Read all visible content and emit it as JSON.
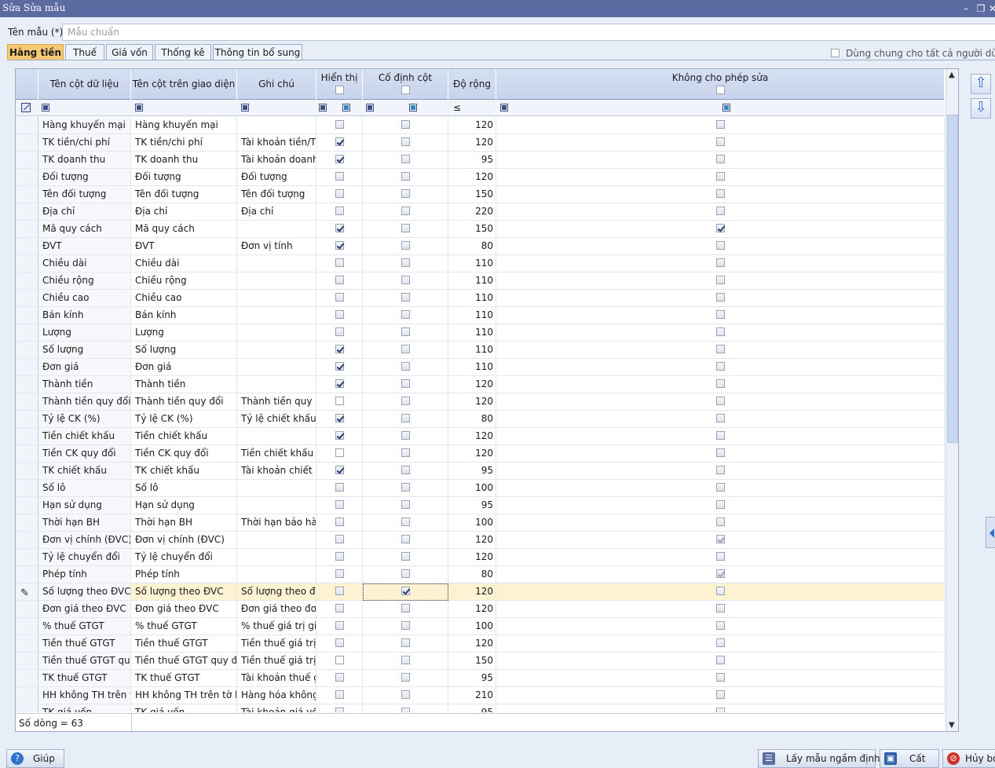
{
  "window": {
    "title": "Sửa Sửa mẫu"
  },
  "form": {
    "name_label": "Tên mẫu (*)",
    "name_value": "Mẫu chuẩn"
  },
  "tabs": [
    "Hàng tiền",
    "Thuế",
    "Giá vốn",
    "Thống kê",
    "Thông tin bổ sung"
  ],
  "shared_label": "Dùng chung cho tất cả người dùng khác",
  "columns": {
    "data_name": "Tên cột dữ liệu",
    "ui_name": "Tên cột trên giao diện",
    "note": "Ghi chú",
    "show": "Hiển thị",
    "fixed": "Cố định cột",
    "width": "Độ rộng",
    "noedit": "Không cho phép sửa"
  },
  "filter_width_op": "≤",
  "rows": [
    {
      "name": "Hàng khuyến mại",
      "ui": "Hàng khuyến mại",
      "note": "",
      "show": "off",
      "fixed": "off",
      "width": "120",
      "noedit": "off"
    },
    {
      "name": "TK tiền/chi phí",
      "ui": "TK tiền/chi phí",
      "note": "Tài khoản tiền/Tài",
      "show": "on",
      "fixed": "off",
      "width": "120",
      "noedit": "off"
    },
    {
      "name": "TK doanh thu",
      "ui": "TK doanh thu",
      "note": "Tài khoản doanh t",
      "show": "on",
      "fixed": "off",
      "width": "95",
      "noedit": "off"
    },
    {
      "name": "Đối tượng",
      "ui": "Đối tượng",
      "note": "Đối tượng",
      "show": "off",
      "fixed": "off",
      "width": "120",
      "noedit": "off"
    },
    {
      "name": "Tên đối tượng",
      "ui": "Tên đối tượng",
      "note": "Tên đối tượng",
      "show": "off",
      "fixed": "off",
      "width": "150",
      "noedit": "off"
    },
    {
      "name": "Địa chỉ",
      "ui": "Địa chỉ",
      "note": "Địa chỉ",
      "show": "off",
      "fixed": "off",
      "width": "220",
      "noedit": "off"
    },
    {
      "name": "Mã quy cách",
      "ui": "Mã quy cách",
      "note": "",
      "show": "on",
      "fixed": "off",
      "width": "150",
      "noedit": "on"
    },
    {
      "name": "ĐVT",
      "ui": "ĐVT",
      "note": "Đơn vị tính",
      "show": "on",
      "fixed": "off",
      "width": "80",
      "noedit": "off"
    },
    {
      "name": "Chiều dài",
      "ui": "Chiều dài",
      "note": "",
      "show": "off",
      "fixed": "off",
      "width": "110",
      "noedit": "off"
    },
    {
      "name": "Chiều rộng",
      "ui": "Chiều rộng",
      "note": "",
      "show": "off",
      "fixed": "off",
      "width": "110",
      "noedit": "off"
    },
    {
      "name": "Chiều cao",
      "ui": "Chiều cao",
      "note": "",
      "show": "off",
      "fixed": "off",
      "width": "110",
      "noedit": "off"
    },
    {
      "name": "Bán kính",
      "ui": "Bán kính",
      "note": "",
      "show": "off",
      "fixed": "off",
      "width": "110",
      "noedit": "off"
    },
    {
      "name": "Lượng",
      "ui": "Lượng",
      "note": "",
      "show": "off",
      "fixed": "off",
      "width": "110",
      "noedit": "off"
    },
    {
      "name": "Số lượng",
      "ui": "Số lượng",
      "note": "",
      "show": "on",
      "fixed": "off",
      "width": "110",
      "noedit": "off"
    },
    {
      "name": "Đơn giá",
      "ui": "Đơn giá",
      "note": "",
      "show": "on",
      "fixed": "off",
      "width": "110",
      "noedit": "off"
    },
    {
      "name": "Thành tiền",
      "ui": "Thành tiền",
      "note": "",
      "show": "on",
      "fixed": "off",
      "width": "120",
      "noedit": "off"
    },
    {
      "name": "Thành tiền quy đổi",
      "ui": "Thành tiền quy đổi",
      "note": "Thành tiền quy đổ",
      "show": "blank",
      "fixed": "off",
      "width": "120",
      "noedit": "off"
    },
    {
      "name": "Tỷ lệ CK (%)",
      "ui": "Tỷ lệ CK (%)",
      "note": "Tỷ lệ chiết khấu (",
      "show": "on",
      "fixed": "off",
      "width": "80",
      "noedit": "off"
    },
    {
      "name": "Tiền chiết khấu",
      "ui": "Tiền chiết khấu",
      "note": "",
      "show": "on",
      "fixed": "off",
      "width": "120",
      "noedit": "off"
    },
    {
      "name": "Tiền CK quy đổi",
      "ui": "Tiền CK quy đổi",
      "note": "Tiền chiết khấu q",
      "show": "blank",
      "fixed": "off",
      "width": "120",
      "noedit": "off"
    },
    {
      "name": "TK chiết khấu",
      "ui": "TK chiết khấu",
      "note": "Tài khoản chiết k",
      "show": "on",
      "fixed": "off",
      "width": "95",
      "noedit": "off"
    },
    {
      "name": "Số lô",
      "ui": "Số lô",
      "note": "",
      "show": "off",
      "fixed": "off",
      "width": "100",
      "noedit": "off"
    },
    {
      "name": "Hạn sử dụng",
      "ui": "Hạn sử dụng",
      "note": "",
      "show": "off",
      "fixed": "off",
      "width": "95",
      "noedit": "off"
    },
    {
      "name": "Thời hạn BH",
      "ui": "Thời hạn BH",
      "note": "Thời hạn bảo hàn",
      "show": "off",
      "fixed": "off",
      "width": "100",
      "noedit": "off"
    },
    {
      "name": "Đơn vị chính (ĐVC)",
      "ui": "Đơn vị chính (ĐVC)",
      "note": "",
      "show": "off",
      "fixed": "off",
      "width": "120",
      "noedit": "dim"
    },
    {
      "name": "Tỷ lệ chuyển đổi",
      "ui": "Tỷ lệ chuyển đổi",
      "note": "",
      "show": "off",
      "fixed": "off",
      "width": "120",
      "noedit": "off"
    },
    {
      "name": "Phép tính",
      "ui": "Phép tính",
      "note": "",
      "show": "off",
      "fixed": "off",
      "width": "80",
      "noedit": "dim"
    },
    {
      "name": "Số lượng theo ĐVC",
      "ui": "Số lượng theo ĐVC",
      "note": "Số lượng theo đơ",
      "show": "off",
      "fixed": "on",
      "width": "120",
      "noedit": "off",
      "selected": true
    },
    {
      "name": "Đơn giá theo ĐVC",
      "ui": "Đơn giá theo ĐVC",
      "note": "Đơn giá theo đơn",
      "show": "off",
      "fixed": "off",
      "width": "120",
      "noedit": "off"
    },
    {
      "name": "% thuế GTGT",
      "ui": "% thuế GTGT",
      "note": "% thuế giá trị gia t",
      "show": "off",
      "fixed": "off",
      "width": "100",
      "noedit": "off"
    },
    {
      "name": "Tiền thuế GTGT",
      "ui": "Tiền thuế GTGT",
      "note": "Tiền thuế giá trị gi",
      "show": "off",
      "fixed": "off",
      "width": "120",
      "noedit": "off"
    },
    {
      "name": "Tiền thuế GTGT quy",
      "ui": "Tiền thuế GTGT quy đổi",
      "note": "Tiền thuế giá trị gi",
      "show": "blank",
      "fixed": "off",
      "width": "150",
      "noedit": "off"
    },
    {
      "name": "TK thuế GTGT",
      "ui": "TK thuế GTGT",
      "note": "Tài khoản thuế gi",
      "show": "off",
      "fixed": "off",
      "width": "95",
      "noedit": "off"
    },
    {
      "name": "HH không TH trên tờ",
      "ui": "HH không TH trên tờ kha",
      "note": "Hàng hóa không t",
      "show": "off",
      "fixed": "off",
      "width": "210",
      "noedit": "off"
    },
    {
      "name": "TK giá vốn",
      "ui": "TK giá vốn",
      "note": "Tài khoản giá vốn",
      "show": "off",
      "fixed": "off",
      "width": "95",
      "noedit": "off"
    }
  ],
  "footer": {
    "row_count": "Số dòng = 63"
  },
  "buttons": {
    "help": "Giúp",
    "default": "Lấy mẫu ngầm định",
    "save": "Cất",
    "cancel": "Hủy bỏ"
  }
}
